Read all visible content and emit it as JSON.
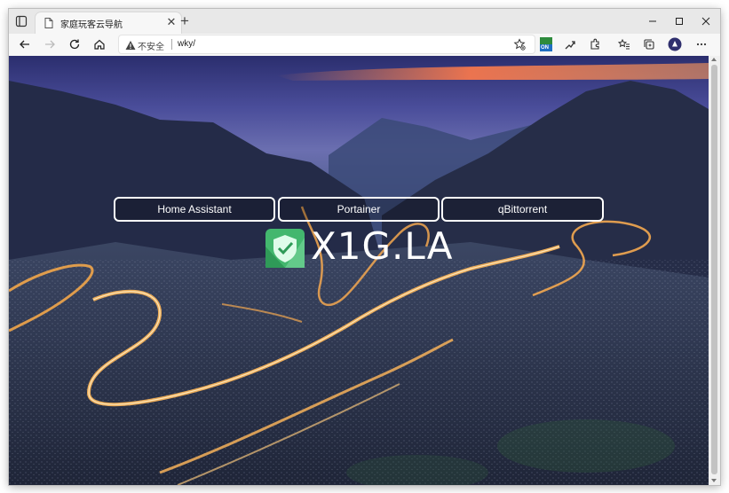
{
  "browser": {
    "tab_title": "家庭玩客云导航",
    "address_not_secure": "不安全",
    "address_url": "wky/",
    "extension_badge": "ON"
  },
  "page": {
    "links": [
      {
        "label": "Home Assistant"
      },
      {
        "label": "Portainer"
      },
      {
        "label": "qBittorrent"
      }
    ],
    "logo_text": "X1G.LA",
    "accent_color": "#3fb86a"
  }
}
